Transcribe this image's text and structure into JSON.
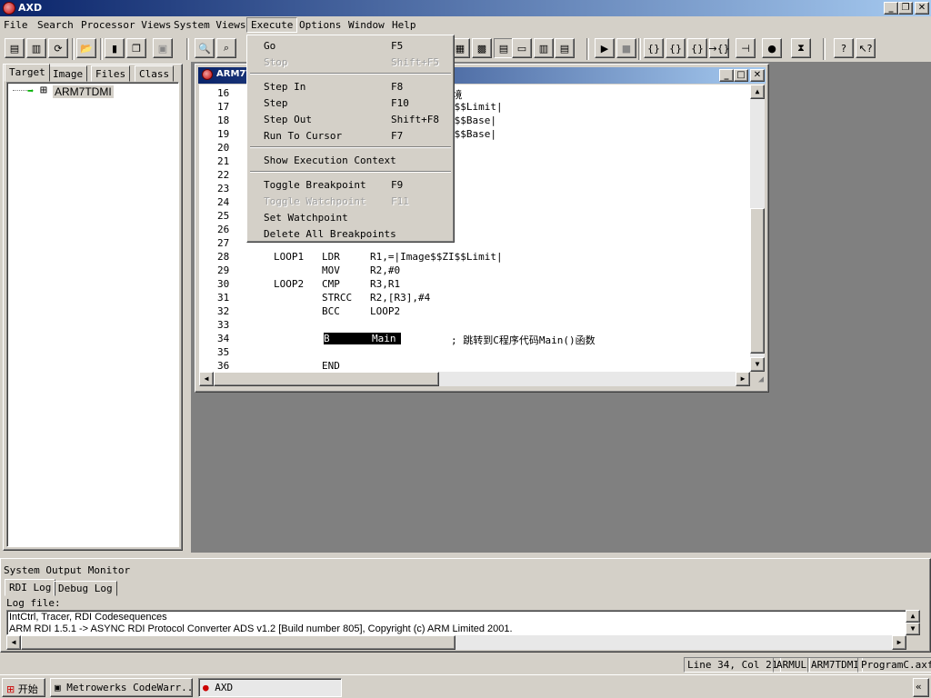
{
  "window": {
    "title": "AXD"
  },
  "menubar": [
    "File",
    "Search",
    "Processor Views",
    "System Views",
    "Execute",
    "Options",
    "Window",
    "Help"
  ],
  "execute_menu": {
    "group1": [
      {
        "label": "Go",
        "key": "F5",
        "enabled": true
      },
      {
        "label": "Stop",
        "key": "Shift+F5",
        "enabled": false
      }
    ],
    "group2": [
      {
        "label": "Step In",
        "key": "F8",
        "enabled": true
      },
      {
        "label": "Step",
        "key": "F10",
        "enabled": true
      },
      {
        "label": "Step Out",
        "key": "Shift+F8",
        "enabled": true
      },
      {
        "label": "Run To Cursor",
        "key": "F7",
        "enabled": true
      }
    ],
    "group3": [
      {
        "label": "Show Execution Context",
        "key": "",
        "enabled": true
      }
    ],
    "group4": [
      {
        "label": "Toggle Breakpoint",
        "key": "F9",
        "enabled": true
      },
      {
        "label": "Toggle Watchpoint",
        "key": "F11",
        "enabled": false
      },
      {
        "label": "Set Watchpoint",
        "key": "",
        "enabled": true
      },
      {
        "label": "Delete All Breakpoints",
        "key": "",
        "enabled": true
      }
    ]
  },
  "left_panel": {
    "tabs": [
      "Target",
      "Image",
      "Files",
      "Class"
    ],
    "tree_item": "ARM7TDMI"
  },
  "code_window": {
    "title_fragment": "ARM7T",
    "lines": [
      {
        "n": "16",
        "text": "                            环境"
      },
      {
        "n": "17",
        "text": "                            RO$$Limit|"
      },
      {
        "n": "18",
        "text": "                            RW$$Base|"
      },
      {
        "n": "19",
        "text": "                            ZI$$Base|"
      },
      {
        "n": "20",
        "text": ""
      },
      {
        "n": "21",
        "text": ""
      },
      {
        "n": "22",
        "text": ""
      },
      {
        "n": "23",
        "text": ""
      },
      {
        "n": "24",
        "text": ""
      },
      {
        "n": "25",
        "text": ""
      },
      {
        "n": "26",
        "text": ""
      },
      {
        "n": "27",
        "text": ""
      },
      {
        "n": "28",
        "text": "LOOP1   LDR     R1,=|Image$$ZI$$Limit|"
      },
      {
        "n": "29",
        "text": "        MOV     R2,#0"
      },
      {
        "n": "30",
        "text": "LOOP2   CMP     R3,R1"
      },
      {
        "n": "31",
        "text": "        STRCC   R2,[R3],#4"
      },
      {
        "n": "32",
        "text": "        BCC     LOOP2"
      },
      {
        "n": "33",
        "text": ""
      },
      {
        "n": "34",
        "text": "B       Main",
        "hl": true,
        "comment": "; 跳转到C程序代码Main()函数"
      },
      {
        "n": "35",
        "text": ""
      },
      {
        "n": "36",
        "text": "        END"
      }
    ]
  },
  "output": {
    "title": "System Output Monitor",
    "tabs": [
      "RDI Log",
      "Debug Log"
    ],
    "log_label": "Log file:",
    "log_lines": [
      "IntCtrl, Tracer, RDI Codesequences",
      "ARM RDI 1.5.1 -> ASYNC RDI Protocol Converter ADS v1.2 [Build number 805], Copyright (c) ARM Limited 2001."
    ]
  },
  "status": [
    "Line 34, Col 21",
    "ARMUL",
    "ARM7TDMI",
    "ProgramC.axf"
  ],
  "taskbar": {
    "start": "开始",
    "tasks": [
      "Metrowerks CodeWarr...",
      "AXD"
    ]
  }
}
